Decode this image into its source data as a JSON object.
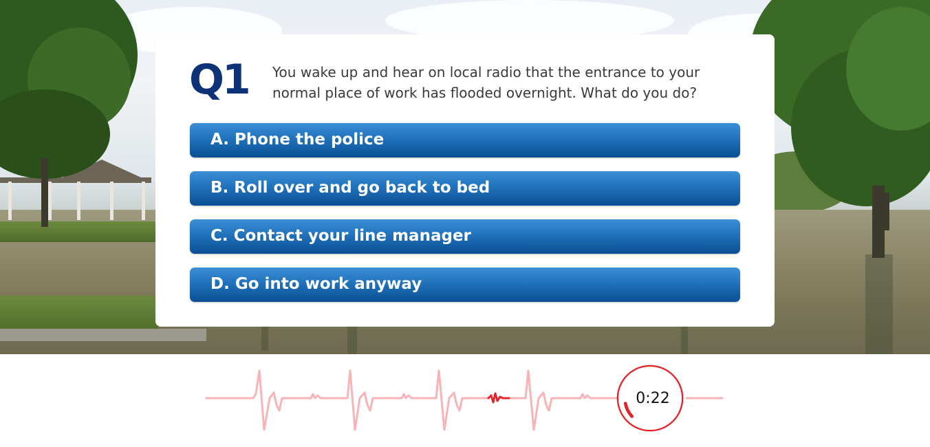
{
  "question": {
    "number": "Q1",
    "text": "You wake up and hear on local radio that the entrance to your normal place of work has flooded overnight. What do you do?"
  },
  "answers": [
    {
      "label": "A. Phone the police"
    },
    {
      "label": "B. Roll over and go back to bed"
    },
    {
      "label": "C. Contact your line manager"
    },
    {
      "label": "D. Go into work anyway"
    }
  ],
  "timer": {
    "display": "0:22",
    "accent_color": "#e3242b",
    "pulse_color": "#f7b3b5"
  },
  "colors": {
    "question_number": "#0e3277",
    "answer_button": "#1e6fb8"
  },
  "icons": {
    "heartbeat": "heartbeat-line-icon",
    "timer": "countdown-timer-icon"
  }
}
